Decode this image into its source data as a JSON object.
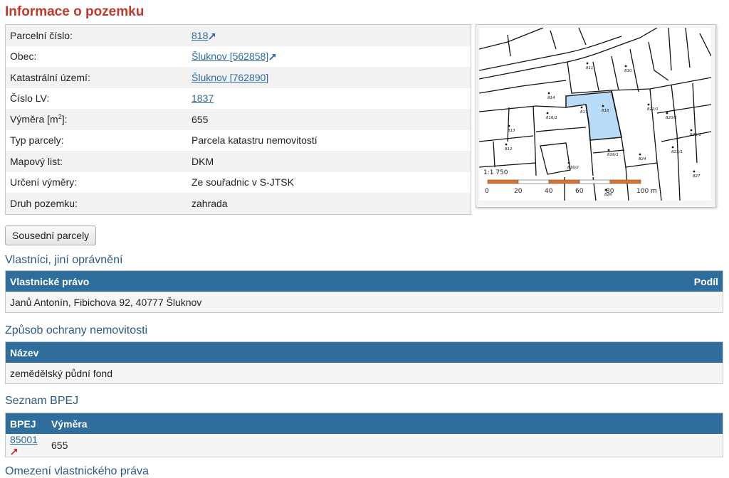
{
  "page_title": "Informace o pozemku",
  "info_rows": [
    {
      "label": "Parcelní číslo:",
      "value": "818",
      "link": true,
      "ext": true
    },
    {
      "label": "Obec:",
      "value": "Šluknov [562858]",
      "link": true,
      "ext": true
    },
    {
      "label": "Katastrální území:",
      "value": "Šluknov [762890]",
      "link": true,
      "ext": false
    },
    {
      "label": "Číslo LV:",
      "value": "1837",
      "link": true,
      "ext": false
    },
    {
      "label": "Výměra [m2]:",
      "value": "655",
      "link": false,
      "ext": false
    },
    {
      "label": "Typ parcely:",
      "value": "Parcela katastru nemovitostí",
      "link": false,
      "ext": false
    },
    {
      "label": "Mapový list:",
      "value": "DKM",
      "link": false,
      "ext": false
    },
    {
      "label": "Určení výměry:",
      "value": "Ze souřadnic v S-JTSK",
      "link": false,
      "ext": false
    },
    {
      "label": "Druh pozemku:",
      "value": "zahrada",
      "link": false,
      "ext": false
    }
  ],
  "area_label": {
    "prefix": "Výměra [m",
    "sup": "2",
    "suffix": "]:"
  },
  "map": {
    "scale_text": "1:1 750",
    "scale_ticks": [
      "0",
      "20",
      "40",
      "60",
      "80",
      "100 m"
    ],
    "parcel_labels": [
      "818",
      "817",
      "814",
      "816/1",
      "816/2",
      "813",
      "812",
      "811",
      "810",
      "822/1",
      "820/1",
      "819/1",
      "823/1",
      "824",
      "825/1",
      "826",
      "827"
    ],
    "highlight_color": "#b8dcf8",
    "scale_color": "#e0702a"
  },
  "neighbor_button": "Sousední parcely",
  "owners": {
    "title": "Vlastníci, jiní oprávnění",
    "col_right": "Vlastnické právo",
    "col_share": "Podíl",
    "rows": [
      "Janů Antonín, Fibichova 92, 40777 Šluknov"
    ]
  },
  "protection": {
    "title": "Způsob ochrany nemovitosti",
    "col_name": "Název",
    "rows": [
      "zemědělský půdní fond"
    ]
  },
  "bpej": {
    "title": "Seznam BPEJ",
    "col_bpej": "BPEJ",
    "col_area": "Výměra",
    "rows": [
      {
        "code": "85001",
        "area": "655"
      }
    ]
  },
  "restrictions": {
    "title": "Omezení vlastnického práva"
  }
}
